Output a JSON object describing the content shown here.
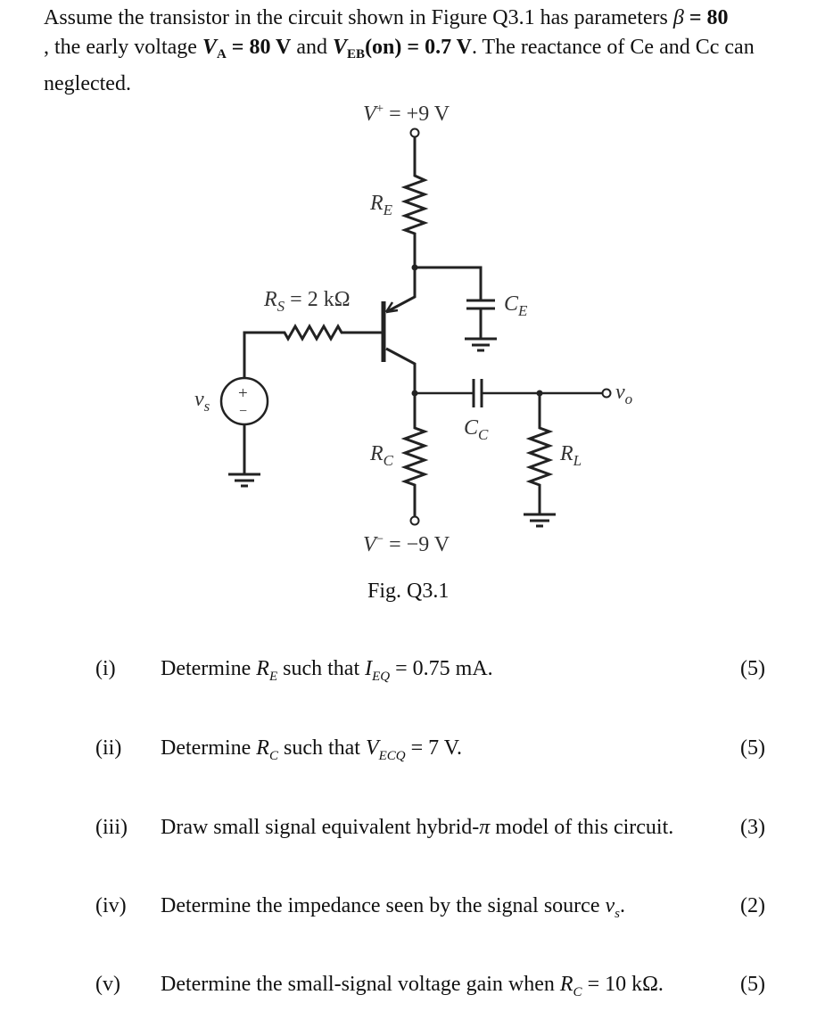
{
  "intro": {
    "t1": "Assume the transistor in the circuit shown in Figure Q3.1 has parameters ",
    "beta_sym": "β",
    "beta_eq": " = 80",
    "t2": ", the early voltage ",
    "va_sym": "V",
    "va_sub": "A",
    "va_eq": " = 80  V",
    "t3": " and ",
    "veb_sym": "V",
    "veb_sub": "EB",
    "veb_eq": "(on) = 0.7  V",
    "t4": ". The reactance of Ce and Cc can neglected."
  },
  "figure": {
    "vplus_label": "V",
    "vplus_sup": "+",
    "vplus_value": " = +9 V",
    "re_label": "R",
    "re_sub": "E",
    "rs_label": "R",
    "rs_sub": "S",
    "rs_value": " = 2 kΩ",
    "ce_label": "C",
    "ce_sub": "E",
    "vs_label": "v",
    "vs_sub": "s",
    "plus_sign": "+",
    "minus_sign": "−",
    "cc_label": "C",
    "cc_sub": "C",
    "vo_label": "v",
    "vo_sub": "o",
    "rc_label": "R",
    "rc_sub": "C",
    "rl_label": "R",
    "rl_sub": "L",
    "vminus_label": "V",
    "vminus_sup": "−",
    "vminus_value": " = −9 V",
    "caption": "Fig. Q3.1"
  },
  "questions": [
    {
      "num": "(i)",
      "pre": "Determine ",
      "sym": "R",
      "sub": "E",
      "mid": " such that ",
      "sym2": "I",
      "sub2": "EQ",
      "post": " = 0.75  mA.",
      "marks": "(5)"
    },
    {
      "num": "(ii)",
      "pre": "Determine ",
      "sym": "R",
      "sub": "C",
      "mid": " such that ",
      "sym2": "V",
      "sub2": "ECQ",
      "post": " = 7  V.",
      "marks": "(5)"
    },
    {
      "num": "(iii)",
      "pre": "Draw small signal equivalent hybrid-",
      "sym": "π",
      "sub": "",
      "mid": "  model of this circuit.",
      "sym2": "",
      "sub2": "",
      "post": "",
      "marks": "(3)"
    },
    {
      "num": "(iv)",
      "pre": "Determine the impedance seen by the signal source  ",
      "sym": "v",
      "sub": "s",
      "mid": ".",
      "sym2": "",
      "sub2": "",
      "post": "",
      "marks": "(2)"
    },
    {
      "num": "(v)",
      "pre": "Determine the small-signal voltage gain when  ",
      "sym": "R",
      "sub": "C",
      "mid": " = 10  kΩ.",
      "sym2": "",
      "sub2": "",
      "post": "",
      "marks": "(5)"
    }
  ]
}
